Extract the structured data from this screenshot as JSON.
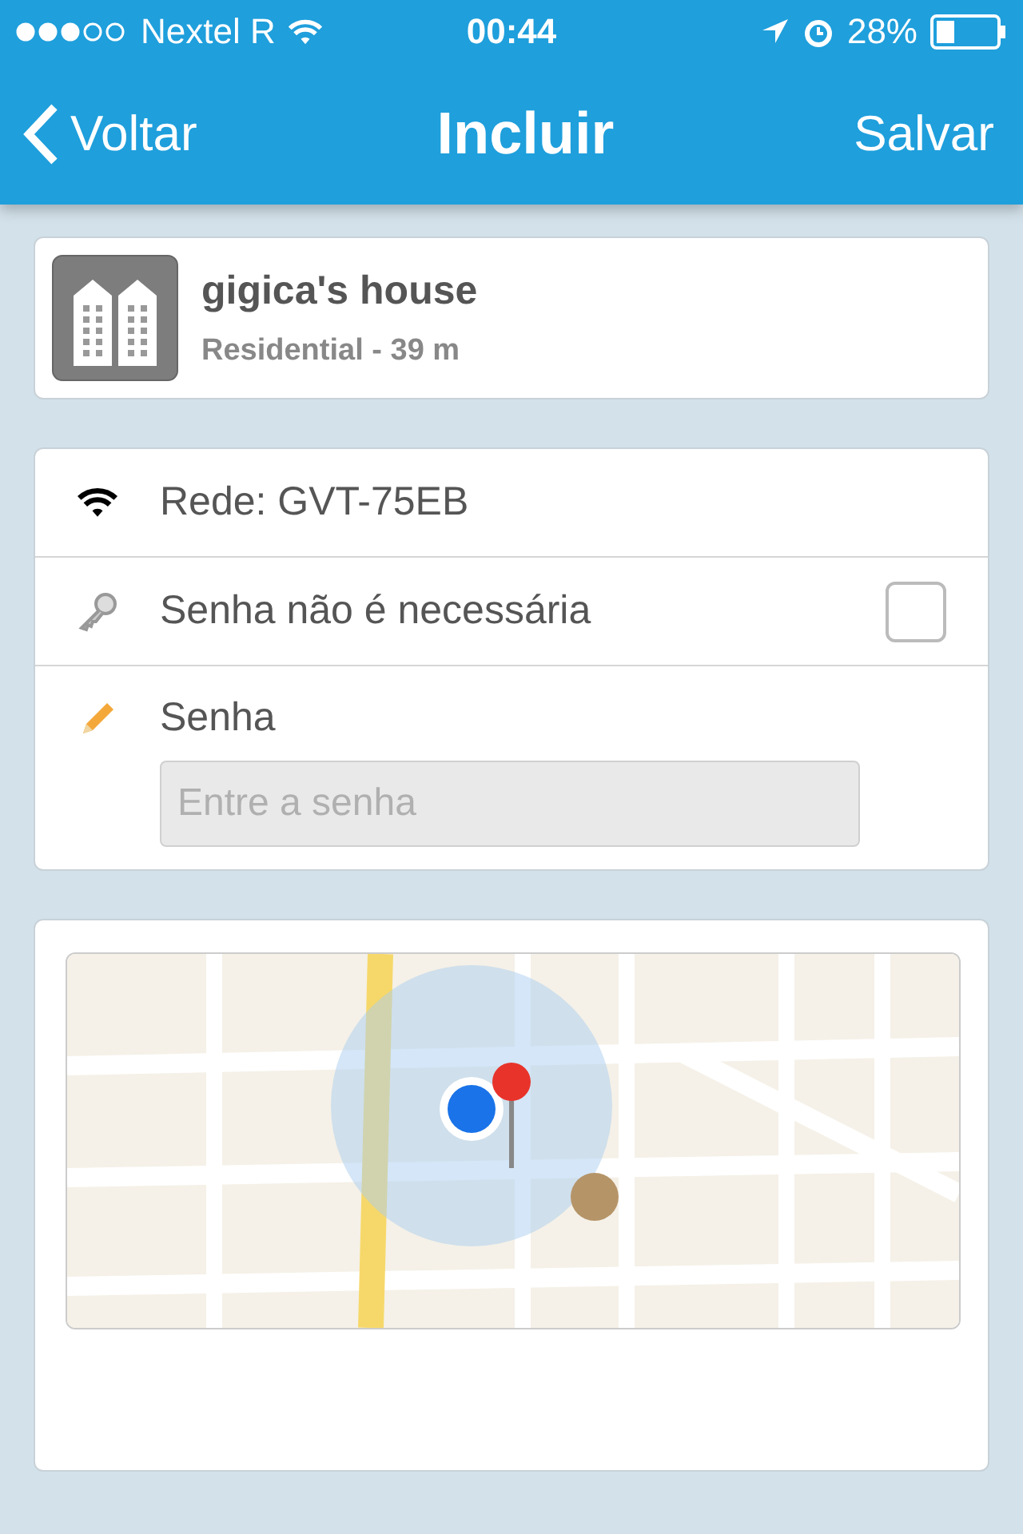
{
  "status_bar": {
    "carrier": "Nextel R",
    "time": "00:44",
    "battery": "28%"
  },
  "nav": {
    "back": "Voltar",
    "title": "Incluir",
    "action": "Salvar"
  },
  "place": {
    "name": "gigica's house",
    "subtitle": "Residential - 39 m"
  },
  "settings": [
    {
      "kind": "network",
      "label": "Rede: GVT-75EB"
    },
    {
      "kind": "checkbox",
      "label": "Senha não é necessária",
      "checked": false
    },
    {
      "kind": "password",
      "label": "Senha",
      "placeholder": "Entre a senha"
    }
  ]
}
